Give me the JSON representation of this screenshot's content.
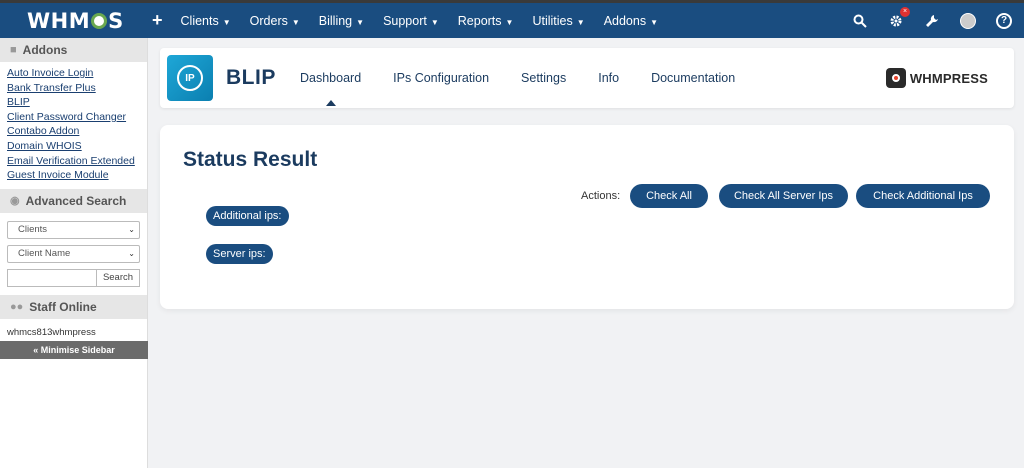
{
  "topbar": {
    "logo_text": "WHMCS",
    "plus": "+",
    "nav": [
      "Clients",
      "Orders",
      "Billing",
      "Support",
      "Reports",
      "Utilities",
      "Addons"
    ],
    "icons": [
      "search-icon",
      "gear-alert-icon",
      "wrench-icon",
      "user-avatar",
      "help-icon"
    ],
    "alert_badge": "×"
  },
  "sidebar": {
    "addons_title": "Addons",
    "addon_links": [
      "Auto Invoice Login",
      "Bank Transfer Plus",
      "BLIP",
      "Client Password Changer",
      "Contabo Addon",
      "Domain WHOIS",
      "Email Verification Extended",
      "Guest Invoice Module"
    ],
    "adv_search_title": "Advanced Search",
    "search_type": "Clients",
    "search_field": "Client Name",
    "search_input": "",
    "search_button": "Search",
    "staff_title": "Staff Online",
    "staff_name": "whmcs813whmpress",
    "minimise_label": "« Minimise Sidebar"
  },
  "module": {
    "title": "BLIP",
    "tabs": [
      "Dashboard",
      "IPs Configuration",
      "Settings",
      "Info",
      "Documentation"
    ],
    "active_tab": "Dashboard",
    "brand": "WHMPRESS"
  },
  "status": {
    "title": "Status Result",
    "actions_label": "Actions:",
    "check_all": "Check All",
    "check_server": "Check All Server Ips",
    "check_additional": "Check Additional Ips",
    "additional_ips_label": "Additional ips:",
    "server_ips_label": "Server ips:"
  },
  "colors": {
    "topbar": "#1a4d80",
    "pill": "#1a4d80",
    "heading": "#1b3b5f"
  }
}
